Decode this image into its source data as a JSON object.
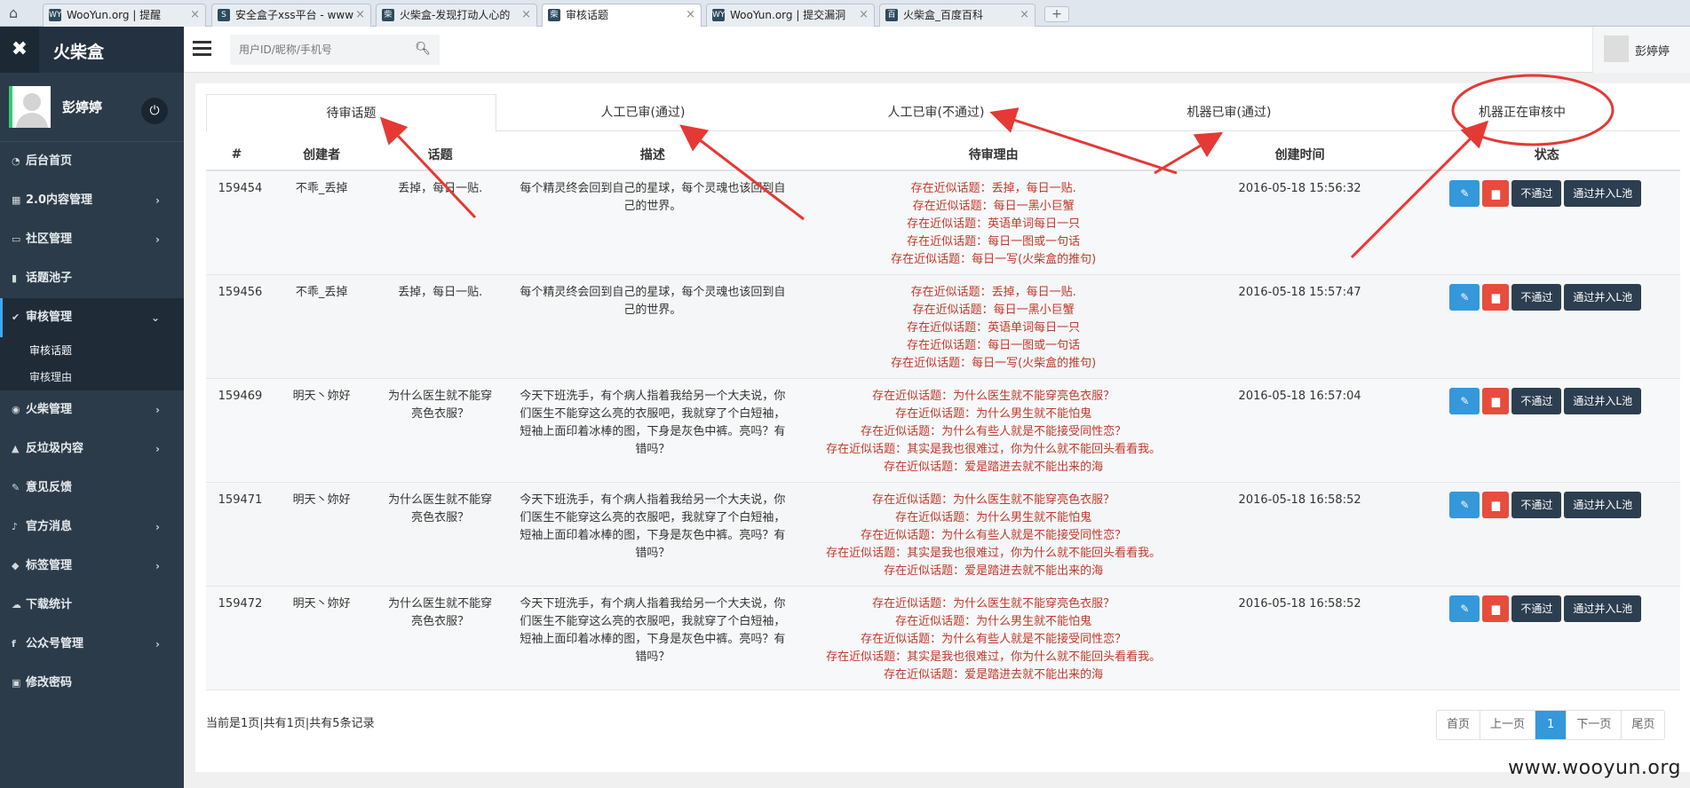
{
  "browser": {
    "tabs": [
      {
        "label": "WooYun.org | 提醒",
        "icon": "WY"
      },
      {
        "label": "安全盒子xss平台 - www",
        "icon": "S"
      },
      {
        "label": "火柴盒-发现打动人心的",
        "icon": "柴"
      },
      {
        "label": "审核话题",
        "icon": "柴"
      },
      {
        "label": "WooYun.org | 提交漏洞",
        "icon": "WY"
      },
      {
        "label": "火柴盒_百度百科",
        "icon": "百"
      }
    ],
    "new_tab": "+",
    "close": "×"
  },
  "sidebar": {
    "app_name": "火柴盒",
    "user_name": "彭婷婷",
    "items": [
      {
        "label": "后台首页",
        "icon": "dashboard-icon",
        "glyph": "◔"
      },
      {
        "label": "2.0内容管理",
        "icon": "calendar-icon",
        "glyph": "▦",
        "chevron": "›"
      },
      {
        "label": "社区管理",
        "icon": "laptop-icon",
        "glyph": "▭",
        "chevron": "›"
      },
      {
        "label": "话题池子",
        "icon": "book-icon",
        "glyph": "▮"
      },
      {
        "label": "审核管理",
        "icon": "check-circle-icon",
        "glyph": "✔",
        "chevron": "⌄"
      },
      {
        "label": "火柴管理",
        "icon": "eye-icon",
        "glyph": "◉",
        "chevron": "›"
      },
      {
        "label": "反垃圾内容",
        "icon": "warning-icon",
        "glyph": "▲",
        "chevron": "›"
      },
      {
        "label": "意见反馈",
        "icon": "pencil-icon",
        "glyph": "✎"
      },
      {
        "label": "官方消息",
        "icon": "bell-icon",
        "glyph": "♪",
        "chevron": "›"
      },
      {
        "label": "标签管理",
        "icon": "tag-icon",
        "glyph": "◆",
        "chevron": "›"
      },
      {
        "label": "下载统计",
        "icon": "cloud-download-icon",
        "glyph": "☁"
      },
      {
        "label": "公众号管理",
        "icon": "facebook-icon",
        "glyph": "f",
        "chevron": "›"
      },
      {
        "label": "修改密码",
        "icon": "lock-icon",
        "glyph": "▣"
      }
    ],
    "sub_items": [
      "审核话题",
      "审核理由"
    ]
  },
  "header": {
    "search_placeholder": "用户ID/昵称/手机号",
    "user_name": "彭婷婷"
  },
  "tabs": [
    {
      "label": "待审话题"
    },
    {
      "label": "人工已审(通过)"
    },
    {
      "label": "人工已审(不通过)"
    },
    {
      "label": "机器已审(通过)"
    },
    {
      "label": "机器正在审核中"
    }
  ],
  "table": {
    "headers": [
      "#",
      "创建者",
      "话题",
      "描述",
      "待审理由",
      "创建时间",
      "状态"
    ],
    "rows": [
      {
        "id": "159454",
        "creator": "不乖_丢掉",
        "topic": "丢掉，每日一贴.",
        "desc": "每个精灵终会回到自己的星球，每个灵魂也该回到自己的世界。",
        "reasons": [
          "存在近似话题：丢掉，每日一贴.",
          "存在近似话题：每日一黑小巨蟹",
          "存在近似话题：英语单词每日一只",
          "存在近似话题：每日一图或一句话",
          "存在近似话题：每日一写(火柴盒的推句)"
        ],
        "time": "2016-05-18 15:56:32"
      },
      {
        "id": "159456",
        "creator": "不乖_丢掉",
        "topic": "丢掉，每日一贴.",
        "desc": "每个精灵终会回到自己的星球，每个灵魂也该回到自己的世界。",
        "reasons": [
          "存在近似话题：丢掉，每日一贴.",
          "存在近似话题：每日一黑小巨蟹",
          "存在近似话题：英语单词每日一只",
          "存在近似话题：每日一图或一句话",
          "存在近似话题：每日一写(火柴盒的推句)"
        ],
        "time": "2016-05-18 15:57:47"
      },
      {
        "id": "159469",
        "creator": "明天丶妳好",
        "topic": "为什么医生就不能穿亮色衣服？",
        "desc": "今天下班洗手，有个病人指着我给另一个大夫说，你们医生不能穿这么亮的衣服吧，我就穿了个白短袖，短袖上面印着冰棒的图，下身是灰色中裤。亮吗？有错吗？",
        "reasons": [
          "存在近似话题：为什么医生就不能穿亮色衣服？",
          "存在近似话题：为什么男生就不能怕鬼",
          "存在近似话题：为什么有些人就是不能接受同性恋？",
          "存在近似话题：其实是我也很难过，你为什么就不能回头看看我。",
          "存在近似话题：爱是踏进去就不能出来的海"
        ],
        "time": "2016-05-18 16:57:04"
      },
      {
        "id": "159471",
        "creator": "明天丶妳好",
        "topic": "为什么医生就不能穿亮色衣服？",
        "desc": "今天下班洗手，有个病人指着我给另一个大夫说，你们医生不能穿这么亮的衣服吧，我就穿了个白短袖，短袖上面印着冰棒的图，下身是灰色中裤。亮吗？有错吗？",
        "reasons": [
          "存在近似话题：为什么医生就不能穿亮色衣服？",
          "存在近似话题：为什么男生就不能怕鬼",
          "存在近似话题：为什么有些人就是不能接受同性恋？",
          "存在近似话题：其实是我也很难过，你为什么就不能回头看看我。",
          "存在近似话题：爱是踏进去就不能出来的海"
        ],
        "time": "2016-05-18 16:58:52"
      },
      {
        "id": "159472",
        "creator": "明天丶妳好",
        "topic": "为什么医生就不能穿亮色衣服？",
        "desc": "今天下班洗手，有个病人指着我给另一个大夫说，你们医生不能穿这么亮的衣服吧，我就穿了个白短袖，短袖上面印着冰棒的图，下身是灰色中裤。亮吗？有错吗？",
        "reasons": [
          "存在近似话题：为什么医生就不能穿亮色衣服？",
          "存在近似话题：为什么男生就不能怕鬼",
          "存在近似话题：为什么有些人就是不能接受同性恋？",
          "存在近似话题：其实是我也很难过，你为什么就不能回头看看我。",
          "存在近似话题：爱是踏进去就不能出来的海"
        ],
        "time": "2016-05-18 16:58:52"
      }
    ],
    "buttons": {
      "reject": "不通过",
      "approve": "通过并入L池"
    }
  },
  "pagination": {
    "info": "当前是1页|共有1页|共有5条记录",
    "items": [
      "首页",
      "上一页",
      "1",
      "下一页",
      "尾页"
    ],
    "current": "1"
  },
  "watermark": "www.wooyun.org",
  "colors": {
    "sidebar": "#2c3b49",
    "accent": "#3498db",
    "danger": "#e74c3c",
    "dark_button": "#2c3e50",
    "reason_text": "#c0392b",
    "annotation": "#e53935"
  }
}
